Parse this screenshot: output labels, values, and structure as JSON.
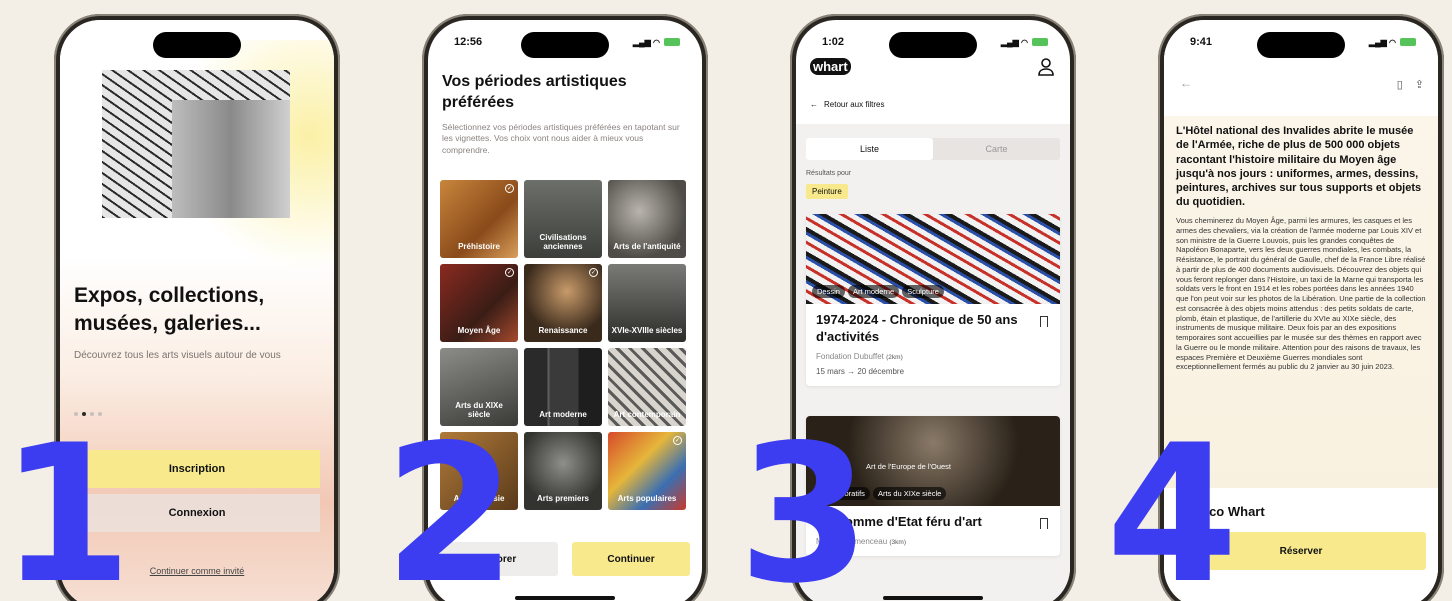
{
  "screen1": {
    "title": "Expos, collections, musées, galeries...",
    "subtitle": "Découvrez tous les arts visuels autour de vous",
    "signup_label": "Inscription",
    "login_label": "Connexion",
    "guest_link": "Continuer comme invité",
    "pager_active": 2,
    "pager_count": 4
  },
  "screen2": {
    "time": "12:56",
    "title": "Vos périodes artistiques préférées",
    "description": "Sélectionnez vos périodes artistiques préférées en tapotant sur les vignettes. Vos choix vont nous aider à mieux vous comprendre.",
    "tiles": [
      {
        "label": "Préhistoire",
        "selected": true
      },
      {
        "label": "Civilisations anciennes",
        "selected": false
      },
      {
        "label": "Arts de l'antiquité",
        "selected": false
      },
      {
        "label": "Moyen Âge",
        "selected": true
      },
      {
        "label": "Renaissance",
        "selected": true
      },
      {
        "label": "XVIe-XVIIIe siècles",
        "selected": false
      },
      {
        "label": "Arts du XIXe siècle",
        "selected": false
      },
      {
        "label": "Art moderne",
        "selected": false
      },
      {
        "label": "Art contemporain",
        "selected": false
      },
      {
        "label": "Arts de l'Asie",
        "selected": false
      },
      {
        "label": "Arts premiers",
        "selected": false
      },
      {
        "label": "Arts populaires",
        "selected": true
      }
    ],
    "skip_label": "Ignorer",
    "continue_label": "Continuer"
  },
  "screen3": {
    "time": "1:02",
    "logo": "whart",
    "back_label": "Retour aux filtres",
    "tab_list": "Liste",
    "tab_map": "Carte",
    "results_label": "Résultats pour",
    "filter_chip": "Peinture",
    "cards": [
      {
        "tags": [
          "Dessin",
          "Art moderne",
          "Sculpture"
        ],
        "title": "1974-2024 - Chronique de 50 ans d'activités",
        "venue": "Fondation Dubuffet",
        "distance": "(2km)",
        "dates": "15 mars → 20 décembre"
      },
      {
        "tags": [
          "Arts décoratifs",
          "Arts du XIXe siècle"
        ],
        "overlay": "Art de l'Europe de l'Ouest",
        "title": "Un homme d'Etat féru d'art",
        "venue": "Musée Clemenceau",
        "distance": "(3km)"
      }
    ]
  },
  "screen4": {
    "time": "9:41",
    "lead": "L'Hôtel national des Invalides abrite le musée de l'Armée, riche de plus de 500 000 objets racontant l'histoire militaire du Moyen âge jusqu'à nos jours : uniformes, armes, dessins, peintures, archives sur tous supports et objets du quotidien.",
    "body": "Vous cheminerez du Moyen Âge, parmi les armures, les casques et les armes des chevaliers, via la création de l'armée moderne par Louis XIV et son ministre de la Guerre Louvois, puis les grandes conquêtes de Napoléon Bonaparte, vers les deux guerres mondiales, les combats, la Résistance, le portrait du général de Gaulle, chef de la France Libre réalisé à partir de plus de 400 documents audiovisuels. Découvrez des objets qui vous feront replonger dans l'Histoire, un taxi de la Marne qui transporta les soldats vers le front en 1914 et les robes portées dans les années 1940 que l'on peut voir sur les photos de la Libération. Une partie de la collection est consacrée à des objets moins attendus : des petits soldats de carte, plomb, étain et plastique, de l'artillerie du XVIe au XIXe siècle, des instruments de musique militaire. Deux fois par an des expositions temporaires sont accueillies par le musée sur des thèmes en rapport avec la Guerre ou le monde militaire. Attention pour des raisons de travaux, les espaces Première et Deuxième Guerres mondiales sont exceptionnellement fermés au public du 2 janvier au 30 juin 2023.",
    "reco_title": "La reco Whart",
    "book_label": "Réserver"
  },
  "step_numbers": [
    "1",
    "2",
    "3",
    "4"
  ],
  "colors": {
    "accent_blue": "#3c3cf0",
    "button_yellow": "#f7e98c",
    "page_bg": "#f4efe6"
  }
}
